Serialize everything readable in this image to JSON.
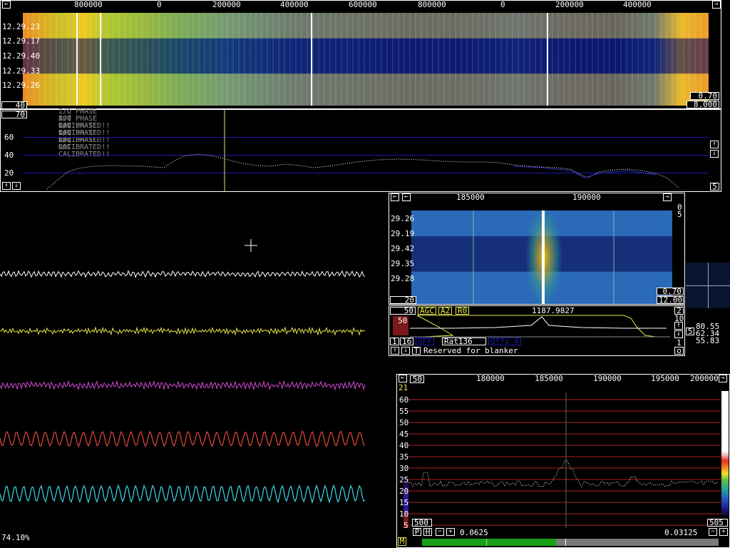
{
  "main_waterfall": {
    "freq_ticks": [
      "800000",
      "0",
      "200000",
      "400000",
      "600000",
      "800000",
      "0",
      "200000",
      "400000"
    ],
    "time_labels": [
      "12.29.23",
      "12.29.17",
      "12.29.40",
      "12.29.33",
      "12.29.26"
    ],
    "gain_box": "40",
    "right_box_top": "0.70",
    "right_box_bottom": "8.000"
  },
  "main_spectrum": {
    "level_box": "70",
    "y_labels": [
      "60",
      "40",
      "20"
    ],
    "warnings": [
      "I/Q PHASE NOT CALIBRATED!!",
      "I/Q PHASE NOT CALIBRATED!!",
      "I/Q PHASE NOT CALIBRATED!!",
      "I/Q PHASE NOT CALIBRATED!!",
      "I/Q PHASE NOT CALIBRATED!!"
    ],
    "right_box": "5"
  },
  "hires_waterfall": {
    "freq_ticks": [
      "185000",
      "190000"
    ],
    "time_labels": [
      "29.26",
      "29.19",
      "29.42",
      "29.35",
      "29.28"
    ],
    "right_top_digits": [
      "0",
      "5"
    ],
    "gain_box": "20",
    "box_top": "0.70",
    "box_bottom": "12.00"
  },
  "baseband": {
    "level_box": "50",
    "agc_label": "AGC",
    "a2_label": "A2",
    "r0_label": "R0",
    "frequency": "1187.9827",
    "right_box": "2",
    "meter_value": "50",
    "scale_top": "10",
    "one_label": "1",
    "sixteen_label": "16",
    "off_label": "OFF",
    "rat_label": "Rat136",
    "offs_label": "Offs 4",
    "t_label": "T",
    "status_text": "Reserved for blanker",
    "five_label": "5",
    "one_right": "1",
    "o_label": "o",
    "side_readouts": [
      "80.55",
      "62.34",
      "55.83"
    ]
  },
  "afc_spectrum": {
    "top_box": "50",
    "freq_ticks": [
      "180000",
      "185000",
      "190000",
      "195000",
      "200000"
    ],
    "corner_value": "21",
    "y_labels": [
      "60",
      "55",
      "50",
      "45",
      "40",
      "35",
      "30",
      "25",
      "20",
      "15",
      "10",
      "5"
    ],
    "left_box": "500",
    "right_box": "505",
    "p_label": "P",
    "h_label": "H",
    "left_value": "0.0625",
    "right_value": "0.03125",
    "m_label": "M"
  },
  "timing": {
    "cpu_load": "74.10%"
  },
  "colors": {
    "trace_white": "#ffffff",
    "trace_yellow": "#e6e64a",
    "trace_magenta": "#d24ad2",
    "trace_red": "#e8483a",
    "trace_cyan": "#3ad8e8",
    "accent_blue": "#1a1aa8",
    "grid_red": "#b02020"
  }
}
